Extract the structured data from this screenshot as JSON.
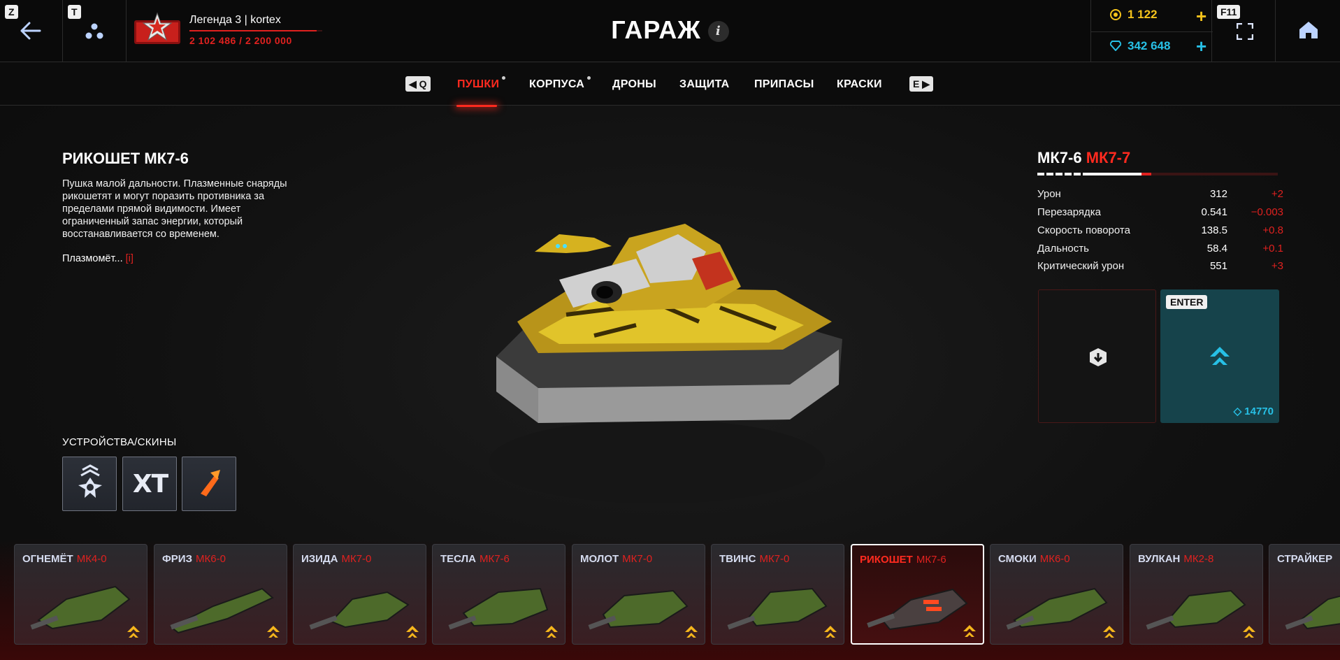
{
  "header": {
    "back_key": "Z",
    "squad_key": "T",
    "player_name": "Легенда 3 | kortex",
    "xp_text": "2 102 486 / 2 200 000",
    "xp_progress": 0.956,
    "title": "ГАРАЖ",
    "info_symbol": "i",
    "crystals": "1 122",
    "gems": "342 648",
    "fullscreen_key": "F11",
    "colors": {
      "crystal": "#f5c31c",
      "gem": "#27c0e6",
      "accent": "#e0211f"
    }
  },
  "tabs": {
    "prev_key": "Q",
    "next_key": "E",
    "items": [
      {
        "label": "ПУШКИ",
        "active": true,
        "dot": true
      },
      {
        "label": "КОРПУСА",
        "active": false,
        "dot": true
      },
      {
        "label": "ДРОНЫ",
        "active": false,
        "dot": false
      },
      {
        "label": "ЗАЩИТА",
        "active": false,
        "dot": false
      },
      {
        "label": "ПРИПАСЫ",
        "active": false,
        "dot": false
      },
      {
        "label": "КРАСКИ",
        "active": false,
        "dot": false
      }
    ]
  },
  "weapon": {
    "name": "РИКОШЕТ МК7-6",
    "description": "Пушка малой дальности. Плазменные снаряды рикошетят и могут поразить противника за пределами прямой видимости. Имеет ограниченный запас энергии, который восстанавливается со временем.",
    "type_label": "Плазмомёт...",
    "type_link": "[i]",
    "devices_label": "УСТРОЙСТВА/СКИНЫ",
    "device_xt_label": "XT"
  },
  "upgrade": {
    "current": "МК7-6",
    "next": "МК7-7",
    "stats": [
      {
        "label": "Урон",
        "value": "312",
        "delta": "+2"
      },
      {
        "label": "Перезарядка",
        "value": "0.541",
        "delta": "−0.003"
      },
      {
        "label": "Скорость поворота",
        "value": "138.5",
        "delta": "+0.8"
      },
      {
        "label": "Дальность",
        "value": "58.4",
        "delta": "+0.1"
      },
      {
        "label": "Критический урон",
        "value": "551",
        "delta": "+3"
      }
    ],
    "enter_key": "ENTER",
    "price": "14770"
  },
  "carousel": [
    {
      "name": "ОГНЕМЁТ",
      "mk": "МК4-0",
      "selected": false
    },
    {
      "name": "ФРИЗ",
      "mk": "МК6-0",
      "selected": false
    },
    {
      "name": "ИЗИДА",
      "mk": "МК7-0",
      "selected": false
    },
    {
      "name": "ТЕСЛА",
      "mk": "МК7-6",
      "selected": false
    },
    {
      "name": "МОЛОТ",
      "mk": "МК7-0",
      "selected": false
    },
    {
      "name": "ТВИНС",
      "mk": "МК7-0",
      "selected": false
    },
    {
      "name": "РИКОШЕТ",
      "mk": "МК7-6",
      "selected": true
    },
    {
      "name": "СМОКИ",
      "mk": "МК6-0",
      "selected": false
    },
    {
      "name": "ВУЛКАН",
      "mk": "МК2-8",
      "selected": false
    },
    {
      "name": "СТРАЙКЕР",
      "mk": "",
      "selected": false
    }
  ]
}
